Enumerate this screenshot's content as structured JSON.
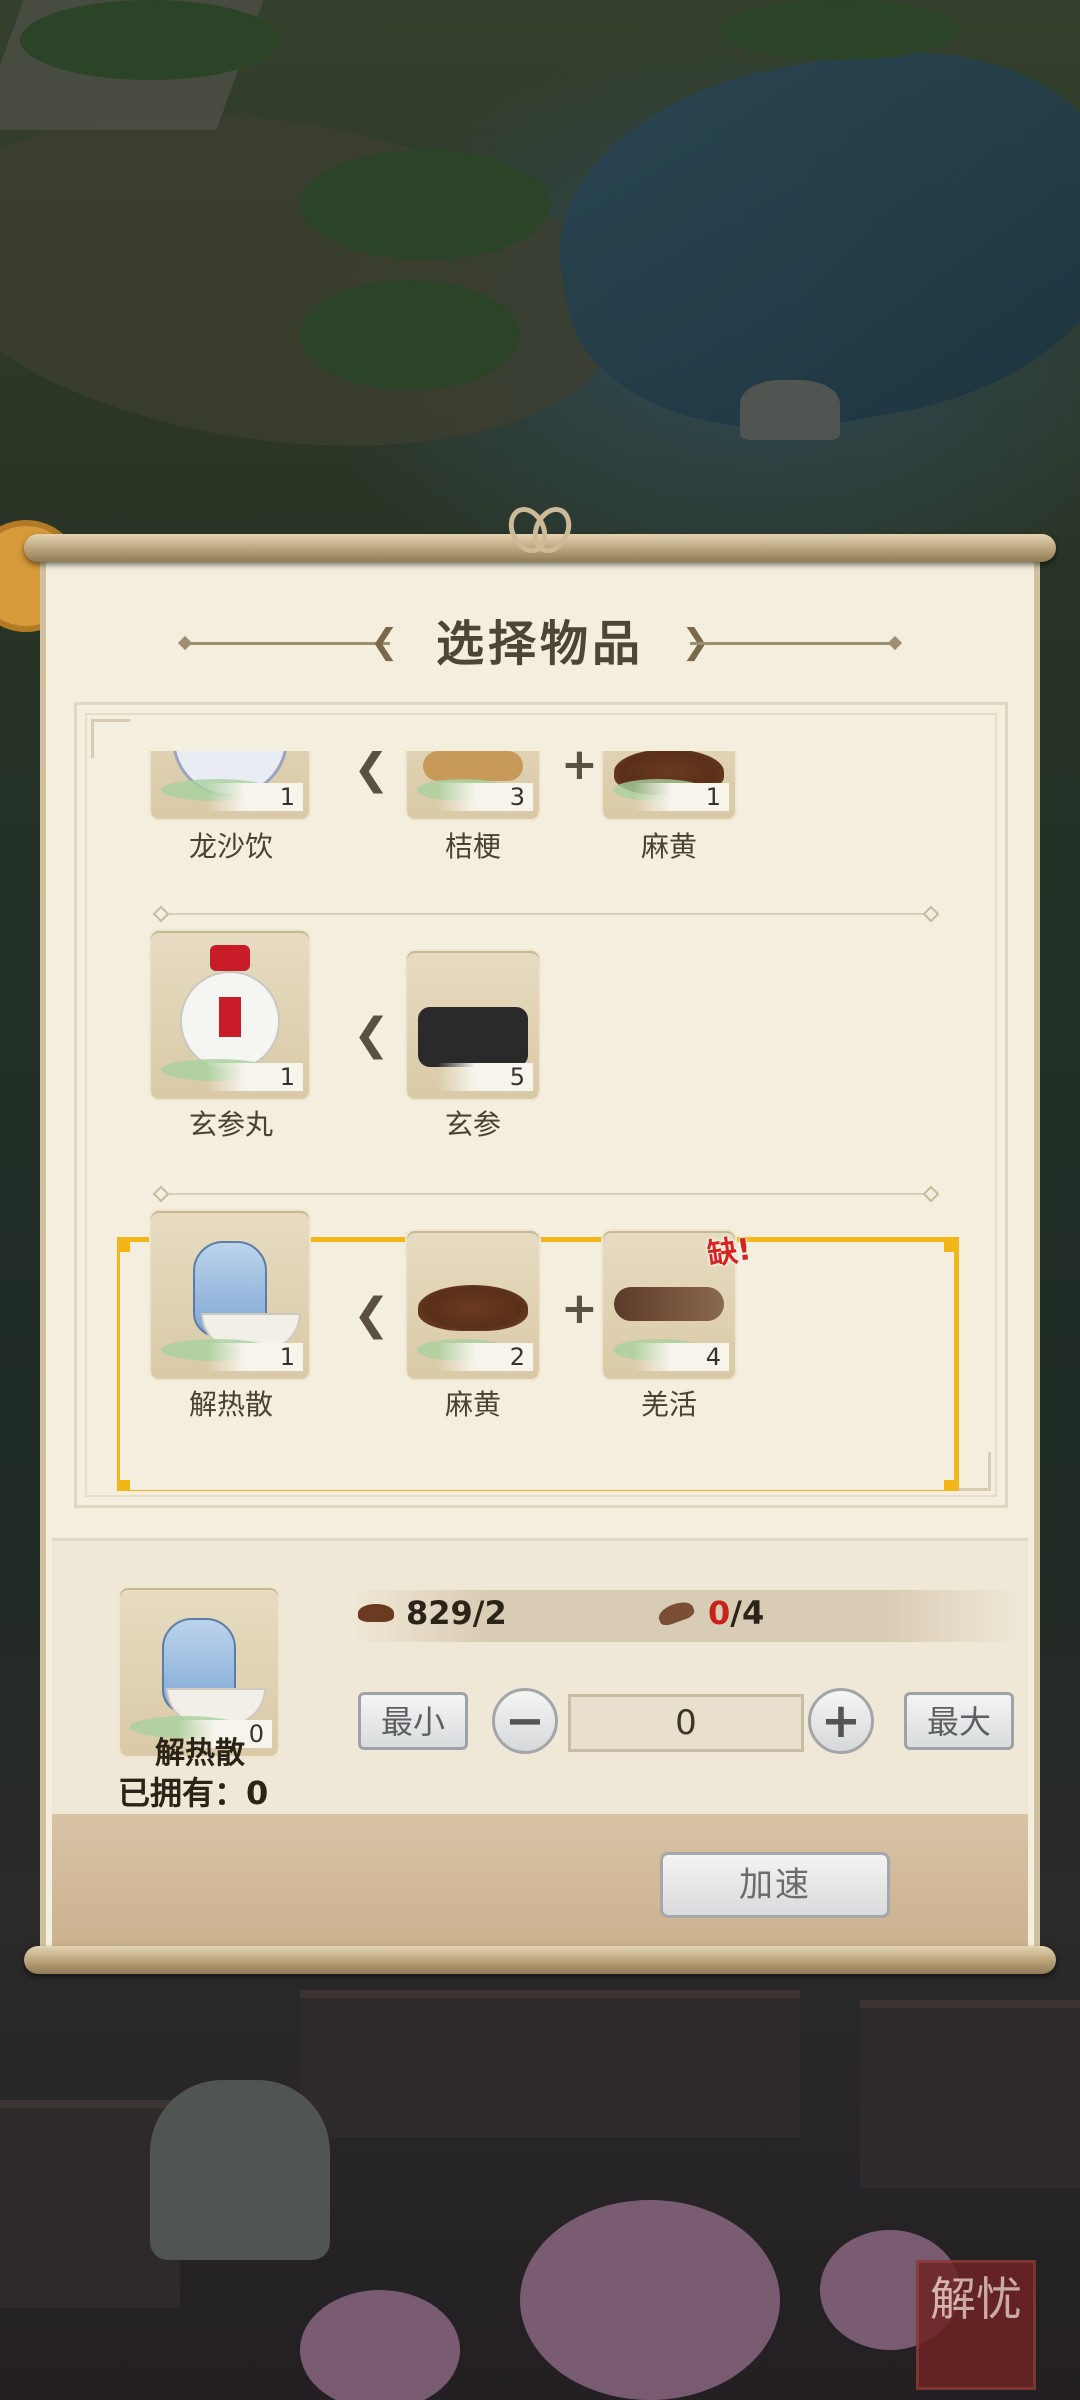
{
  "dialog": {
    "title": "选择物品"
  },
  "recipes": [
    {
      "product": {
        "name": "龙沙饮",
        "count": "1"
      },
      "ingredients": [
        {
          "name": "桔梗",
          "count": "3"
        },
        {
          "name": "麻黄",
          "count": "1"
        }
      ]
    },
    {
      "product": {
        "name": "玄参丸",
        "count": "1"
      },
      "ingredients": [
        {
          "name": "玄参",
          "count": "5"
        }
      ]
    },
    {
      "product": {
        "name": "解热散",
        "count": "1"
      },
      "ingredients": [
        {
          "name": "麻黄",
          "count": "2"
        },
        {
          "name": "羌活",
          "count": "4",
          "lack_label": "缺!"
        }
      ],
      "selected": true
    }
  ],
  "selection": {
    "name": "解热散",
    "count": "0",
    "owned_label": "已拥有：0",
    "resource1": {
      "have": "829",
      "need": "/2"
    },
    "resource2": {
      "have": "0",
      "need": "/4"
    },
    "min_label": "最小",
    "max_label": "最大",
    "minus_label": "−",
    "plus_label": "+",
    "quantity": "0",
    "speed_label": "加速"
  },
  "decor": {
    "seal_text": "解忧"
  },
  "colors": {
    "highlight": "#f2b619",
    "lack": "#d8241c",
    "panel": "#f3eedd"
  }
}
